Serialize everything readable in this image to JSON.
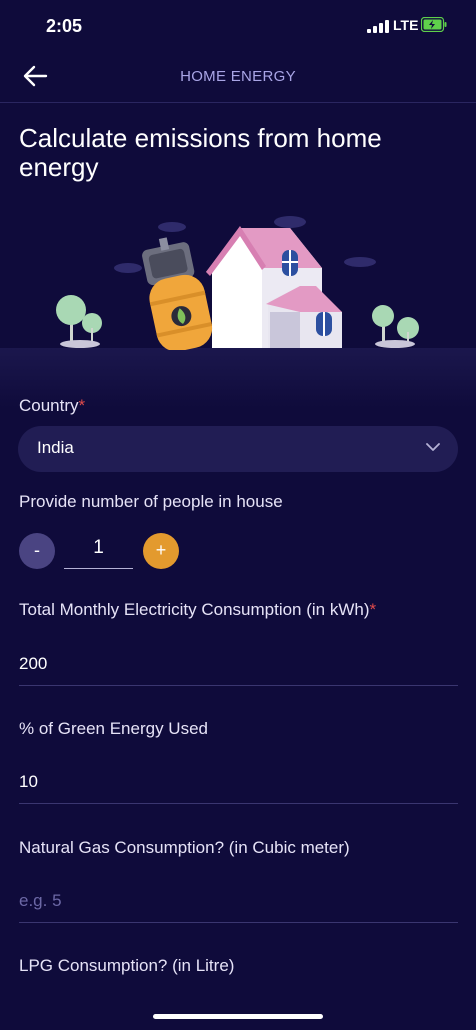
{
  "status": {
    "time": "2:05",
    "network": "LTE"
  },
  "header": {
    "title": "HOME ENERGY"
  },
  "page": {
    "title": "Calculate emissions from home energy"
  },
  "form": {
    "country": {
      "label": "Country",
      "required_mark": "*",
      "value": "India"
    },
    "people": {
      "label": "Provide number of people in house",
      "minus": "-",
      "value": "1",
      "plus": "+"
    },
    "electricity": {
      "label": "Total Monthly Electricity Consumption (in kWh)",
      "required_mark": "*",
      "value": "200"
    },
    "green_energy": {
      "label": "% of Green Energy Used",
      "value": "10"
    },
    "natural_gas": {
      "label": "Natural Gas Consumption? (in Cubic meter)",
      "placeholder": "e.g. 5"
    },
    "lpg": {
      "label": "LPG Consumption? (in Litre)"
    }
  },
  "colors": {
    "background": "#0f0b3b",
    "accent_orange": "#e39a2e",
    "minus_button": "#4a4482",
    "required": "#e04b4b",
    "battery_green": "#5fd04b"
  },
  "icons": [
    "signal-icon",
    "battery-charging-icon",
    "back-arrow-icon",
    "chevron-down-icon",
    "house-illustration",
    "gas-cylinder-illustration",
    "tree-illustration",
    "cloud-illustration"
  ]
}
